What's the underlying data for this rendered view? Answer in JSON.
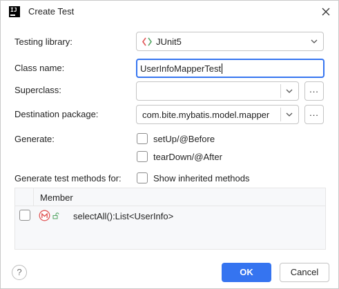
{
  "window": {
    "title": "Create Test",
    "app_icon_text": "IJ"
  },
  "form": {
    "testing_library": {
      "label": "Testing library:",
      "value": "JUnit5"
    },
    "class_name": {
      "label": "Class name:",
      "value": "UserInfoMapperTest"
    },
    "superclass": {
      "label": "Superclass:",
      "value": "",
      "browse": "..."
    },
    "destination_package": {
      "label": "Destination package:",
      "value": "com.bite.mybatis.model.mapper",
      "browse": "..."
    },
    "generate": {
      "label": "Generate:",
      "options": [
        {
          "label": "setUp/@Before",
          "checked": false
        },
        {
          "label": "tearDown/@After",
          "checked": false
        }
      ]
    },
    "methods_for": {
      "label": "Generate test methods for:",
      "show_inherited_label": "Show inherited methods",
      "show_inherited_checked": false
    }
  },
  "members_table": {
    "column_member": "Member",
    "rows": [
      {
        "member": "selectAll():List<UserInfo>",
        "checked": false,
        "icon": "method-icon",
        "visibility_icon": "public-lock-icon"
      }
    ]
  },
  "footer": {
    "help": "?",
    "ok": "OK",
    "cancel": "Cancel"
  },
  "colors": {
    "accent": "#3574f0",
    "junit_red": "#e05555",
    "junit_green": "#59a869"
  }
}
